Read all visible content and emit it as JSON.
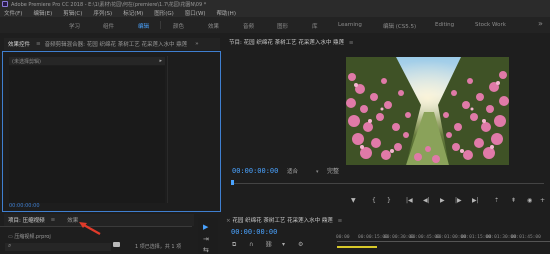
{
  "titlebar": {
    "title": "Adobe Premiere Pro CC 2018 - E:\\1\\素材\\花园\\何在(premiere\\1.7\\花园\\花園N\\09 *"
  },
  "menu": [
    "文件(F)",
    "编辑(E)",
    "剪辑(C)",
    "序列(S)",
    "标记(M)",
    "图形(G)",
    "窗口(W)",
    "帮助(H)"
  ],
  "workspaces": [
    "学习",
    "组件",
    "编辑",
    "颜色",
    "效果",
    "音频",
    "图形",
    "库",
    "Learning",
    "编辑 (CS5.5)",
    "Editing",
    "Stock Work"
  ],
  "active_workspace_index": 2,
  "effect_controls": {
    "tabs": [
      "效果控件",
      "音频剪辑混合器: 花园 织绵花 茶树工艺 花采莲入水中 鼎莲",
      "»"
    ],
    "no_clip_label": "(未选择剪辑)",
    "timecode": "00:00:00:00"
  },
  "program_monitor": {
    "title": "节目: 花园 织绵花 茶树工艺 花采莲入水中 鼎莲",
    "timecode": "00:00:00:00",
    "fit": "适合",
    "full": "完整",
    "controls": [
      "marker-icon",
      "in-point-icon",
      "out-point-icon",
      "go-to-in-icon",
      "step-back-icon",
      "play-icon",
      "step-forward-icon",
      "go-to-out-icon",
      "lift-icon",
      "extract-icon",
      "export-frame-icon",
      "add-icon"
    ]
  },
  "project": {
    "tabs": [
      "项目: 压缩视频",
      "效果"
    ],
    "sub_label": "压缩视频.prproj",
    "selection_count": "1 项已选择，共 1 项"
  },
  "timeline": {
    "title": "花园 织绵花 茶树工艺 花采莲入水中 鼎莲",
    "timecode": "00:00:00:00",
    "ruler_labels": [
      "00:00",
      "00:00:15:00",
      "00:00:30:00",
      "00:00:45:00",
      "00:01:00:00",
      "00:01:15:00",
      "00:01:30:00",
      "00:01:45:00",
      "00:02:00:00"
    ]
  },
  "colors": {
    "accent": "#4aa3ff",
    "panel_bg": "#1d1d1d",
    "highlight_bar": "#d8c92a",
    "annotation_arrow": "#e03a2a"
  }
}
